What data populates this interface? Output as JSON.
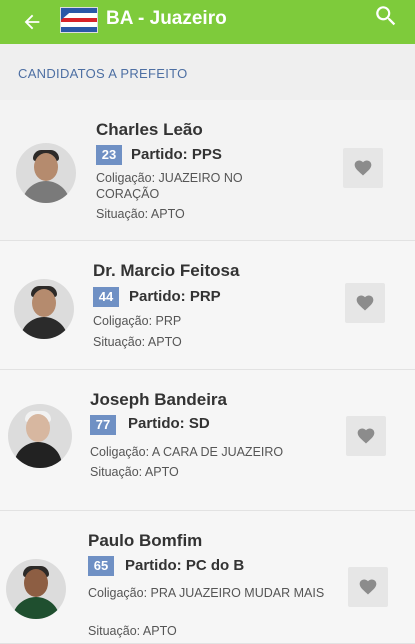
{
  "header": {
    "title": "BA - Juazeiro"
  },
  "section_title": "CANDIDATOS A PREFEITO",
  "candidates": [
    {
      "name": "Charles Leão",
      "number": "23",
      "party": "Partido: PPS",
      "coalition": "Coligação: JUAZEIRO NO CORAÇÃO",
      "situation": "Situação: APTO"
    },
    {
      "name": "Dr. Marcio Feitosa",
      "number": "44",
      "party": "Partido: PRP",
      "coalition": "Coligação: PRP",
      "situation": "Situação: APTO"
    },
    {
      "name": "Joseph Bandeira",
      "number": "77",
      "party": "Partido: SD",
      "coalition": "Coligação: A CARA DE JUAZEIRO",
      "situation": "Situação: APTO"
    },
    {
      "name": "Paulo Bomfim",
      "number": "65",
      "party": "Partido: PC do B",
      "coalition": "Coligação: PRA JUAZEIRO MUDAR MAIS",
      "situation": "Situação: APTO"
    }
  ],
  "colors": {
    "header": "#7ecb3b",
    "badge": "#6f90c4",
    "section": "#4d6fa3"
  }
}
